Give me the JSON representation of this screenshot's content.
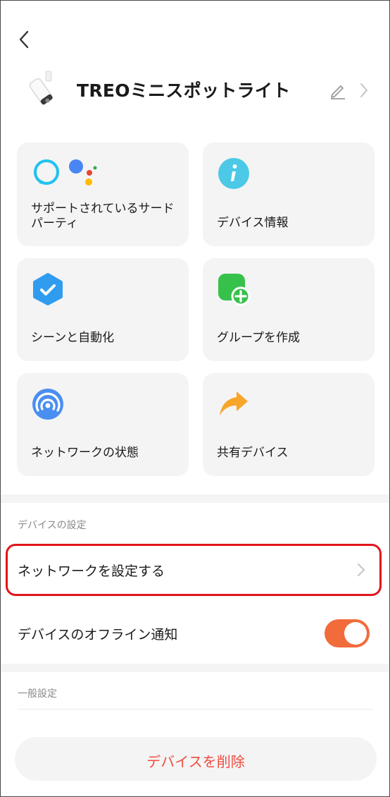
{
  "header": {
    "title": "TREOミニスポットライト"
  },
  "cards": [
    {
      "name": "third-party",
      "label_line1": "サポートされているサード",
      "label_line2": "パーティ",
      "icons": [
        "alexa-icon",
        "google-assistant-icon"
      ]
    },
    {
      "name": "device-info",
      "label": "デバイス情報",
      "icon": "info-icon",
      "color": "#4cc9e6"
    },
    {
      "name": "scene-automation",
      "label": "シーンと自動化",
      "icon": "checkmark-shield-icon",
      "color": "#2f9cf0"
    },
    {
      "name": "create-group",
      "label": "グループを作成",
      "icon": "add-group-icon",
      "color": "#36c24a"
    },
    {
      "name": "network-status",
      "label": "ネットワークの状態",
      "icon": "signal-icon",
      "color": "#4a8ef0"
    },
    {
      "name": "shared-devices",
      "label": "共有デバイス",
      "icon": "share-arrow-icon",
      "color": "#f8a52b"
    }
  ],
  "device_settings": {
    "section_title": "デバイスの設定",
    "network_setup_label": "ネットワークを設定する",
    "offline_notification_label": "デバイスのオフライン通知",
    "offline_notification_enabled": true
  },
  "general_settings": {
    "section_title": "一般設定"
  },
  "delete_button": {
    "label": "デバイスを削除"
  },
  "colors": {
    "accent": "#f26b3a",
    "danger": "#ef4b3f",
    "highlight": "#e1141b"
  }
}
